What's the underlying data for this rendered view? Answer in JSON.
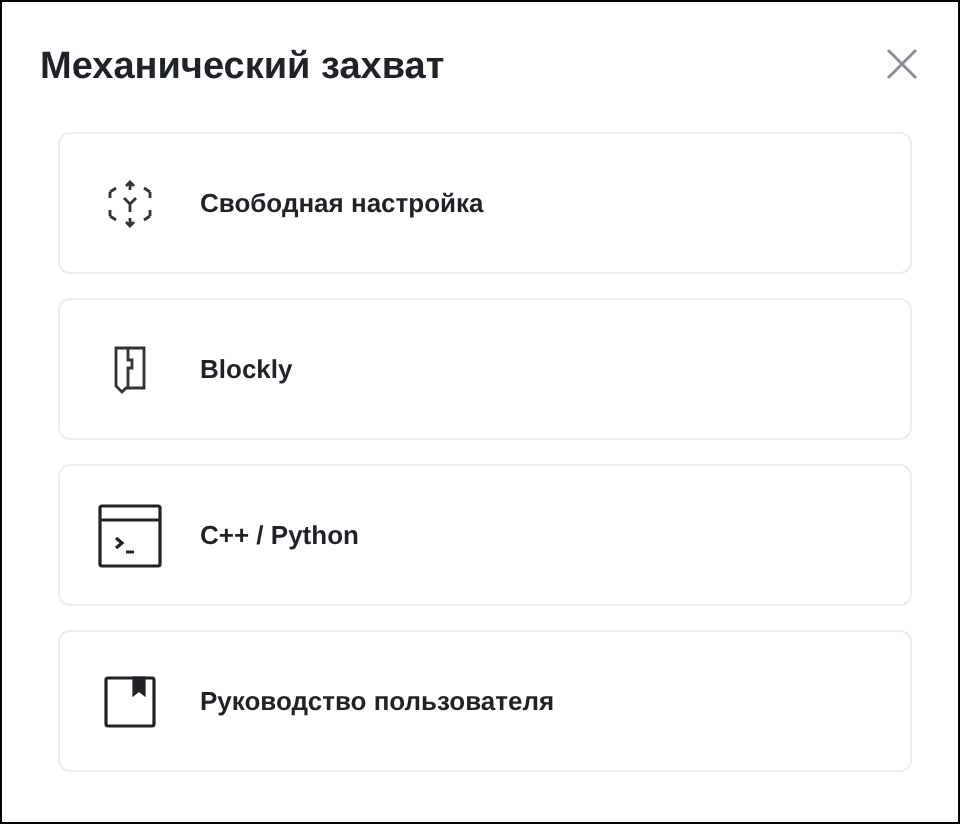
{
  "dialog": {
    "title": "Механический захват"
  },
  "options": [
    {
      "kind": "free",
      "label": "Свободная настройка"
    },
    {
      "kind": "blocks",
      "label": "Blockly"
    },
    {
      "kind": "code",
      "label": "C++ / Python"
    },
    {
      "kind": "manual",
      "label": "Руководство пользователя"
    }
  ]
}
